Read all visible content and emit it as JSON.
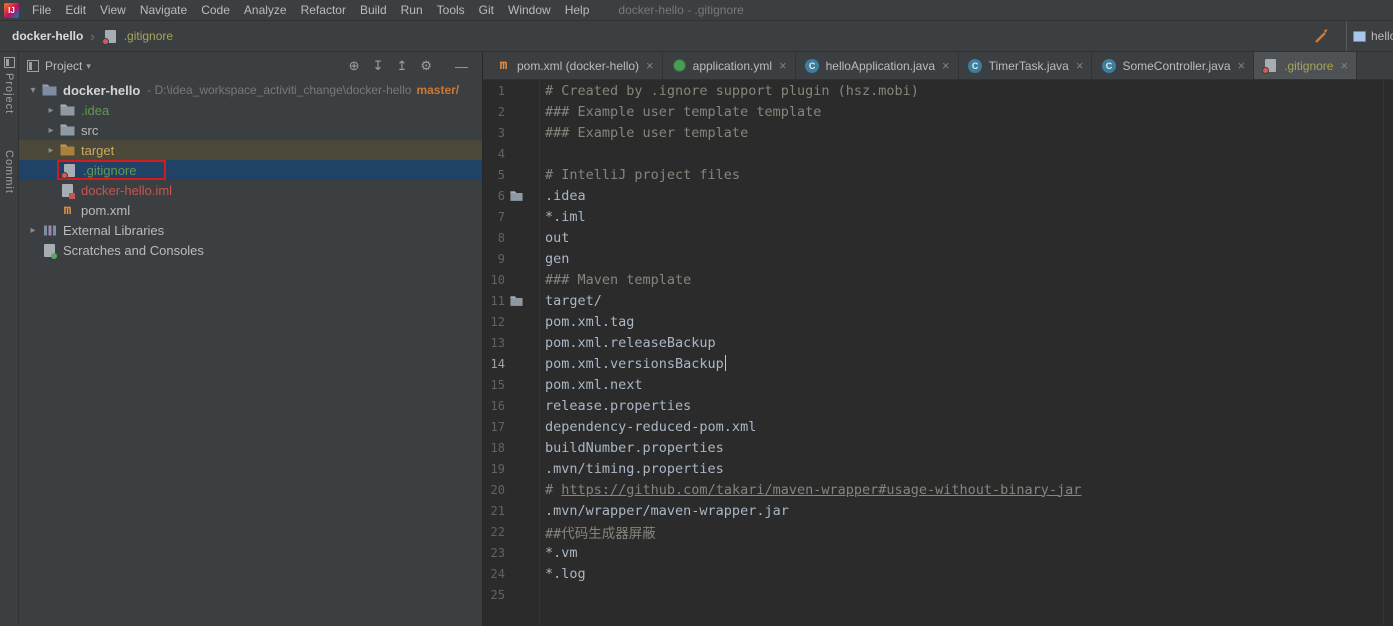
{
  "menu_bar": {
    "items": [
      "File",
      "Edit",
      "View",
      "Navigate",
      "Code",
      "Analyze",
      "Refactor",
      "Build",
      "Run",
      "Tools",
      "Git",
      "Window",
      "Help"
    ],
    "window_title": "docker-hello - .gitignore"
  },
  "breadcrumb": {
    "project": "docker-hello",
    "file": ".gitignore"
  },
  "nav_right": {
    "partial_tab": "hello"
  },
  "tool_stripe": {
    "top_label": "Project",
    "bottom_label": "Commit"
  },
  "project_panel": {
    "title": "Project",
    "toolbar_icons": [
      {
        "name": "locate-file",
        "glyph": "⊕"
      },
      {
        "name": "expand-all",
        "glyph": "↧"
      },
      {
        "name": "collapse-all",
        "glyph": "↥"
      },
      {
        "name": "settings-gear",
        "glyph": "⚙"
      },
      {
        "name": "hide-panel",
        "glyph": "—"
      }
    ],
    "tree": [
      {
        "label": "docker-hello",
        "icon": "project",
        "level": 0,
        "chevron": "down",
        "bold": true,
        "color": "plain",
        "path": "- D:\\idea_workspace_activiti_change\\docker-hello",
        "branch": "master/"
      },
      {
        "label": ".idea",
        "icon": "folder",
        "level": 1,
        "chevron": "right",
        "color": "green"
      },
      {
        "label": "src",
        "icon": "folder",
        "level": 1,
        "chevron": "right",
        "color": "plain"
      },
      {
        "label": "target",
        "icon": "folder-excluded",
        "level": 1,
        "chevron": "right",
        "color": "orange",
        "row": "excluded"
      },
      {
        "label": ".gitignore",
        "icon": "gitignore",
        "level": 1,
        "color": "green",
        "row": "selected",
        "annotated": true
      },
      {
        "label": "docker-hello.iml",
        "icon": "iml",
        "level": 1,
        "color": "red"
      },
      {
        "label": "pom.xml",
        "icon": "maven",
        "level": 1,
        "color": "plain"
      },
      {
        "label": "External Libraries",
        "icon": "libraries",
        "level": 0,
        "chevron": "right",
        "color": "plain"
      },
      {
        "label": "Scratches and Consoles",
        "icon": "scratches",
        "level": 0,
        "color": "plain"
      }
    ]
  },
  "editor": {
    "tabs": [
      {
        "label": "pom.xml (docker-hello)",
        "icon": "maven",
        "active": false
      },
      {
        "label": "application.yml",
        "icon": "yml",
        "active": false
      },
      {
        "label": "helloApplication.java",
        "icon": "class",
        "active": false
      },
      {
        "label": "TimerTask.java",
        "icon": "class",
        "active": false
      },
      {
        "label": "SomeController.java",
        "icon": "class",
        "active": false
      },
      {
        "label": ".gitignore",
        "icon": "gitignore",
        "active": true
      }
    ],
    "lines": [
      {
        "n": 1,
        "type": "comment",
        "text": "# Created by .ignore support plugin (hsz.mobi)"
      },
      {
        "n": 2,
        "type": "comment",
        "text": "### Example user template template"
      },
      {
        "n": 3,
        "type": "comment",
        "text": "### Example user template"
      },
      {
        "n": 4,
        "type": "blank",
        "text": ""
      },
      {
        "n": 5,
        "type": "comment",
        "text": "# IntelliJ project files"
      },
      {
        "n": 6,
        "type": "plain",
        "text": ".idea",
        "gutter_icon": "folder"
      },
      {
        "n": 7,
        "type": "plain",
        "text": "*.iml"
      },
      {
        "n": 8,
        "type": "plain",
        "text": "out"
      },
      {
        "n": 9,
        "type": "plain",
        "text": "gen"
      },
      {
        "n": 10,
        "type": "comment",
        "text": "### Maven template"
      },
      {
        "n": 11,
        "type": "plain",
        "text": "target/",
        "gutter_icon": "folder"
      },
      {
        "n": 12,
        "type": "plain",
        "text": "pom.xml.tag"
      },
      {
        "n": 13,
        "type": "plain",
        "text": "pom.xml.releaseBackup"
      },
      {
        "n": 14,
        "type": "plain",
        "text": "pom.xml.versionsBackup",
        "caret": true,
        "current": true
      },
      {
        "n": 15,
        "type": "plain",
        "text": "pom.xml.next"
      },
      {
        "n": 16,
        "type": "plain",
        "text": "release.properties"
      },
      {
        "n": 17,
        "type": "plain",
        "text": "dependency-reduced-pom.xml"
      },
      {
        "n": 18,
        "type": "plain",
        "text": "buildNumber.properties"
      },
      {
        "n": 19,
        "type": "plain",
        "text": ".mvn/timing.properties"
      },
      {
        "n": 20,
        "type": "comment",
        "text": "# ",
        "link": "https://github.com/takari/maven-wrapper#usage-without-binary-jar"
      },
      {
        "n": 21,
        "type": "plain",
        "text": ".mvn/wrapper/maven-wrapper.jar"
      },
      {
        "n": 22,
        "type": "comment",
        "text": "##代码生成器屏蔽"
      },
      {
        "n": 23,
        "type": "plain",
        "text": "*.vm"
      },
      {
        "n": 24,
        "type": "plain",
        "text": "*.log"
      },
      {
        "n": 25,
        "type": "blank",
        "text": ""
      }
    ]
  },
  "colors": {
    "panel_bg": "#3c3f41",
    "editor_bg": "#2b2b2b",
    "selection_blue": "#204266",
    "excluded_brown": "#4b483a",
    "vcs_green": "#629755",
    "olive_ignored": "#a6a558",
    "branch_orange": "#cc7832",
    "error_red": "#c75450",
    "annotation_red": "#d41a1a",
    "comment_gray": "#84867a",
    "editor_text": "#a9b7c6"
  }
}
